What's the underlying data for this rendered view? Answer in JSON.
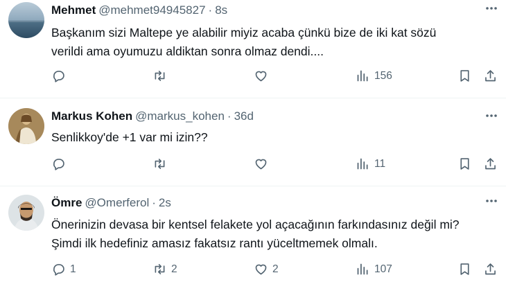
{
  "tweets": [
    {
      "name": "Mehmet",
      "handle": "@mehmet94945827",
      "separator": "·",
      "time": "8s",
      "lines": [
        "Başkanım sizi Maltepe ye alabilir miyiz acaba çünkü bize de iki kat sözü",
        "verildi ama oyumuzu aldiktan sonra olmaz dendi...."
      ],
      "replies": "",
      "reposts": "",
      "likes": "",
      "views": "156"
    },
    {
      "name": "Markus Kohen",
      "handle": "@markus_kohen",
      "separator": "·",
      "time": "36d",
      "lines": [
        "Senlikkoy'de +1 var mi izin??"
      ],
      "replies": "",
      "reposts": "",
      "likes": "",
      "views": "11"
    },
    {
      "name": "Ömre",
      "handle": "@Omerferol",
      "separator": "·",
      "time": "2s",
      "lines": [
        "Önerinizin devasa bir kentsel felakete yol açacağının farkındasınız değil mi?",
        "Şimdi ilk hedefiniz amasız fakatsız rantı yüceltmemek olmalı."
      ],
      "replies": "1",
      "reposts": "2",
      "likes": "2",
      "views": "107"
    }
  ],
  "icons": {
    "reply": "reply-icon",
    "repost": "repost-icon",
    "like": "heart-icon",
    "views": "views-icon",
    "bookmark": "bookmark-icon",
    "share": "share-icon",
    "more": "more-icon"
  },
  "colors": {
    "text": "#0f1419",
    "secondary": "#536471",
    "divider": "#eff3f4"
  }
}
